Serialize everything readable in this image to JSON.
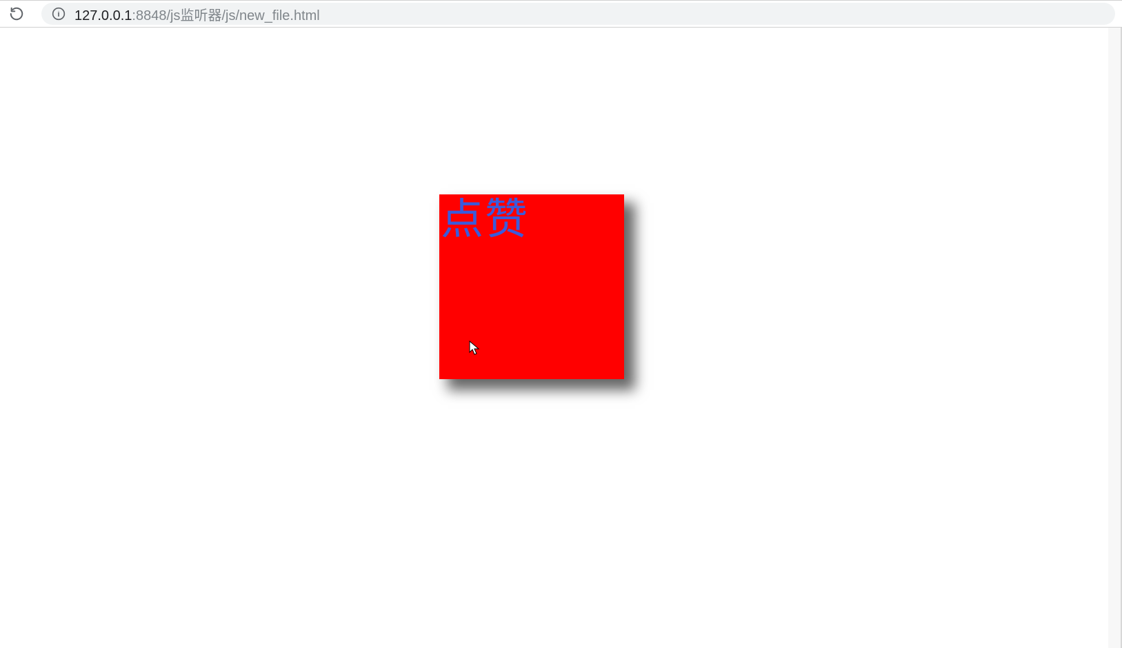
{
  "browser": {
    "url_host": "127.0.0.1",
    "url_rest": ":8848/js监听器/js/new_file.html"
  },
  "box": {
    "label": "点赞",
    "bg_color": "#ff0000",
    "text_color": "#3a5bdc"
  }
}
